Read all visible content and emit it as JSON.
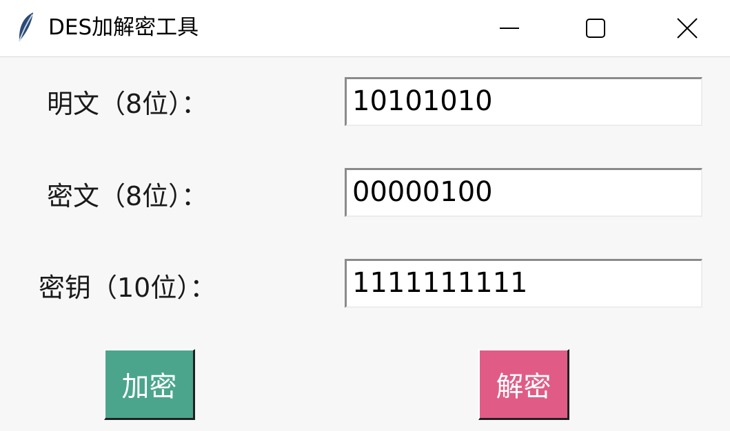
{
  "window": {
    "title": "DES加解密工具",
    "controls": {
      "minimize": "—",
      "maximize": "☐",
      "close": "✕"
    }
  },
  "form": {
    "plaintext": {
      "label": "明文（8位）：",
      "value": "10101010"
    },
    "ciphertext": {
      "label": "密文（8位）：",
      "value": "00000100"
    },
    "key": {
      "label": "密钥（10位）：",
      "value": "1111111111"
    }
  },
  "buttons": {
    "encrypt": {
      "label": "加密",
      "color": "#4aa58c"
    },
    "decrypt": {
      "label": "解密",
      "color": "#e05c86"
    }
  },
  "icons": {
    "app": "feather-icon",
    "minimize": "minimize-icon",
    "maximize": "maximize-icon",
    "close": "close-icon"
  }
}
